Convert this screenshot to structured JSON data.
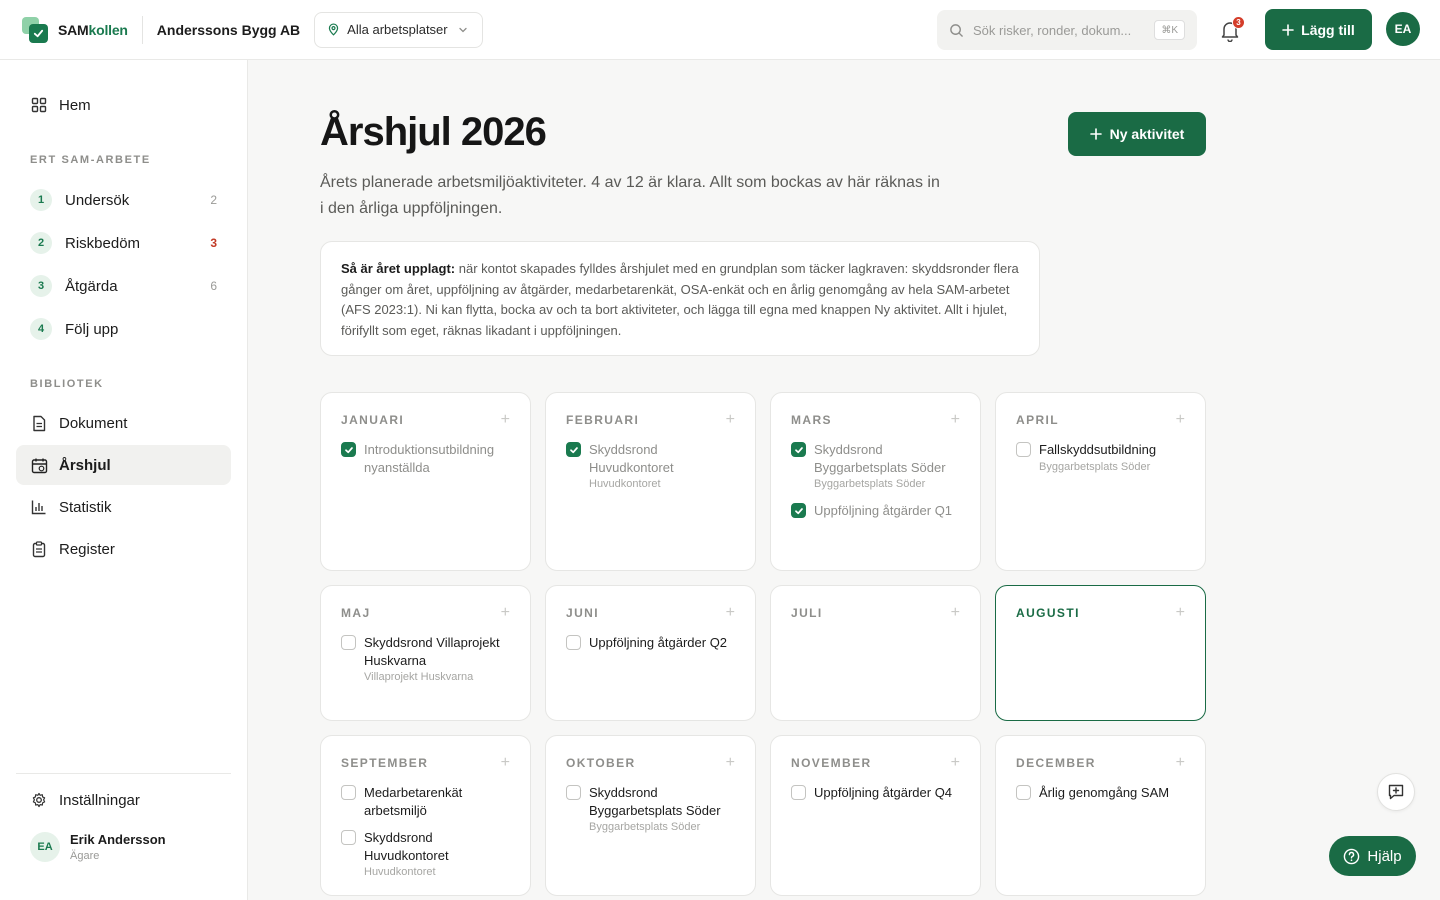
{
  "app": {
    "brand_part1": "SAM",
    "brand_part2": "kollen",
    "company": "Anderssons Bygg AB",
    "workplace_select": "Alla arbetsplatser",
    "search_placeholder": "Sök risker, ronder, dokum...",
    "search_shortcut": "⌘K",
    "notifications_count": "3",
    "add_button": "Lägg till",
    "avatar_initials": "EA",
    "accent_color": "#1a6b45"
  },
  "sidebar": {
    "home": "Hem",
    "sam_section": "ERT SAM-ARBETE",
    "steps": [
      {
        "num": "1",
        "label": "Undersök",
        "count": "2"
      },
      {
        "num": "2",
        "label": "Riskbedöm",
        "count": "3"
      },
      {
        "num": "3",
        "label": "Åtgärda",
        "count": "6"
      },
      {
        "num": "4",
        "label": "Följ upp",
        "count": ""
      }
    ],
    "library_section": "BIBLIOTEK",
    "library": [
      {
        "label": "Dokument",
        "icon": "document-icon"
      },
      {
        "label": "Årshjul",
        "icon": "calendar-icon",
        "active": true
      },
      {
        "label": "Statistik",
        "icon": "chart-icon"
      },
      {
        "label": "Register",
        "icon": "clipboard-icon"
      }
    ],
    "settings": "Inställningar",
    "user": {
      "initials": "EA",
      "name": "Erik Andersson",
      "role": "Ägare"
    }
  },
  "main": {
    "title": "Årshjul 2026",
    "new_activity": "Ny aktivitet",
    "description": "Årets planerade arbetsmiljöaktiviteter. 4 av 12 är klara. Allt som bockas av här räknas in i den årliga uppföljningen.",
    "info_bold": "Så är året upplagt:",
    "info_text": " när kontot skapades fylldes årshjulet med en grundplan som täcker lagkraven: skyddsronder flera gånger om året, uppföljning av åtgärder, medarbetarenkät, OSA-enkät och en årlig genomgång av hela SAM-arbetet (AFS 2023:1). Ni kan flytta, bocka av och ta bort aktiviteter, och lägga till egna med knappen Ny aktivitet. Allt i hjulet, förifyllt som eget, räknas likadant i uppföljningen.",
    "months": [
      {
        "name": "JANUARI",
        "activities": [
          {
            "title": "Introduktionsutbildning nyanställda",
            "sub": "",
            "done": true
          }
        ]
      },
      {
        "name": "FEBRUARI",
        "activities": [
          {
            "title": "Skyddsrond Huvudkontoret",
            "sub": "Huvudkontoret",
            "done": true
          }
        ]
      },
      {
        "name": "MARS",
        "activities": [
          {
            "title": "Skyddsrond Byggarbetsplats Söder",
            "sub": "Byggarbetsplats Söder",
            "done": true
          },
          {
            "title": "Uppföljning åtgärder Q1",
            "sub": "",
            "done": true
          }
        ]
      },
      {
        "name": "APRIL",
        "activities": [
          {
            "title": "Fallskyddsutbildning",
            "sub": "Byggarbetsplats Söder",
            "done": false
          }
        ]
      },
      {
        "name": "MAJ",
        "activities": [
          {
            "title": "Skyddsrond Villaprojekt Huskvarna",
            "sub": "Villaprojekt Huskvarna",
            "done": false
          }
        ]
      },
      {
        "name": "JUNI",
        "activities": [
          {
            "title": "Uppföljning åtgärder Q2",
            "sub": "",
            "done": false
          }
        ]
      },
      {
        "name": "JULI",
        "activities": []
      },
      {
        "name": "AUGUSTI",
        "activities": [],
        "current": true
      },
      {
        "name": "SEPTEMBER",
        "activities": [
          {
            "title": "Medarbetarenkät arbetsmiljö",
            "sub": "",
            "done": false
          },
          {
            "title": "Skyddsrond Huvudkontoret",
            "sub": "Huvudkontoret",
            "done": false
          }
        ]
      },
      {
        "name": "OKTOBER",
        "activities": [
          {
            "title": "Skyddsrond Byggarbetsplats Söder",
            "sub": "Byggarbetsplats Söder",
            "done": false
          }
        ]
      },
      {
        "name": "NOVEMBER",
        "activities": [
          {
            "title": "Uppföljning åtgärder Q4",
            "sub": "",
            "done": false
          }
        ]
      },
      {
        "name": "DECEMBER",
        "activities": [
          {
            "title": "Årlig genomgång SAM",
            "sub": "",
            "done": false
          }
        ]
      }
    ]
  },
  "help": {
    "label": "Hjälp"
  }
}
